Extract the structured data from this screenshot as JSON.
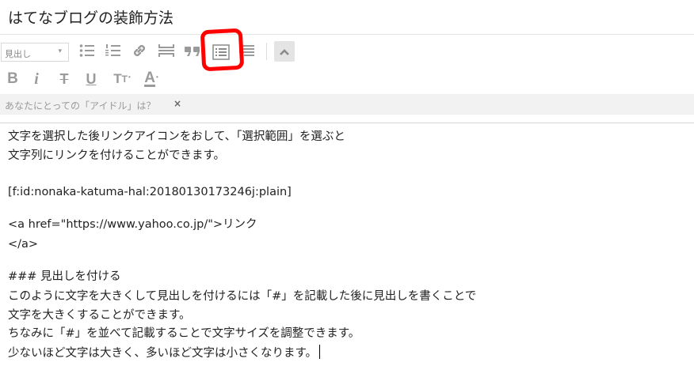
{
  "title": "はてなブログの装飾方法",
  "toolbar": {
    "heading_select_label": "見出し",
    "heading_select_caret": "▾",
    "bold_label": "B",
    "italic_label": "i",
    "strike_label": "T",
    "underline_label": "U",
    "text_size_label": "T",
    "text_size_small": "T",
    "text_size_dot": "•",
    "text_color_label": "A",
    "text_color_dot": "•",
    "icons": [
      "unordered-list-icon",
      "ordered-list-icon",
      "link-icon",
      "read-more-icon",
      "blockquote-icon",
      "table-of-contents-icon",
      "footnote-icon",
      "chevron-up-icon"
    ]
  },
  "annotation": {
    "color": "#ff0000"
  },
  "tag": {
    "text": "あなたにとっての「アイドル」は？",
    "close": "×"
  },
  "editor": {
    "lines": [
      "文字を選択した後リンクアイコンをおして、「選択範囲」を選ぶと",
      "文字列にリンクを付けることができます。",
      "[f:id:nonaka-katuma-hal:20180130173246j:plain]",
      "<a href=\"https://www.yahoo.co.jp/\">リンク",
      "</a>",
      "### 見出しを付ける",
      "このように文字を大きくして見出しを付けるには「#」を記載した後に見出しを書くことで",
      "文字を大きくすることができます。",
      "ちなみに「#」を並べて記載することで文字サイズを調整できます。",
      "少ないほど文字は大きく、多いほど文字は小さくなります。"
    ]
  }
}
